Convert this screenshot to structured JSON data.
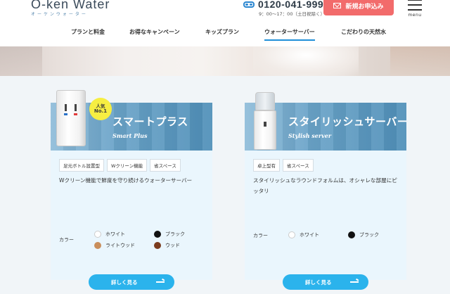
{
  "header": {
    "logo": "O-ken Water",
    "logo_sub": "オーケンウォーター",
    "tel": "0120-041-999",
    "hours": "9：00〜17：00（土日祝除く）",
    "apply_label": "新規お申込み",
    "menu_label": "menu"
  },
  "nav": {
    "items": [
      {
        "label": "プランと料金"
      },
      {
        "label": "お得なキャンペーン"
      },
      {
        "label": "キッズプラン"
      },
      {
        "label": "ウォーターサーバー",
        "active": true
      },
      {
        "label": "こだわりの天然水"
      }
    ]
  },
  "cards": [
    {
      "title": "スマートプラス",
      "subtitle": "Smart Plus",
      "badge_line1": "人気",
      "badge_line2": "No.1",
      "tags": [
        "足元ボトル設置型",
        "Wクリーン機能",
        "省スペース"
      ],
      "description": "Wクリーン機能で鮮度を守り続けるウォーターサーバー",
      "color_label": "カラー",
      "colors": [
        {
          "name": "ホワイト",
          "hex": "#ffffff"
        },
        {
          "name": "ブラック",
          "hex": "#111111"
        },
        {
          "name": "ライトウッド",
          "hex": "#c98e5c"
        },
        {
          "name": "ウッド",
          "hex": "#7a3b1e"
        }
      ],
      "button_label": "詳しく見る"
    },
    {
      "title": "スタイリッシュサーバー",
      "subtitle": "Stylish server",
      "tags": [
        "卓上型有",
        "省スペース"
      ],
      "description": "スタイリッシュなラウンドフォルムは、オシャレな部屋にピッタリ",
      "color_label": "カラー",
      "colors": [
        {
          "name": "ホワイト",
          "hex": "#ffffff"
        },
        {
          "name": "ブラック",
          "hex": "#111111"
        }
      ],
      "button_label": "詳しく見る"
    }
  ],
  "colors": {
    "accent": "#2bb3ec",
    "apply": "#f26b6b",
    "nav_active": "#1f8fd8",
    "badge": "#f6ee42"
  }
}
